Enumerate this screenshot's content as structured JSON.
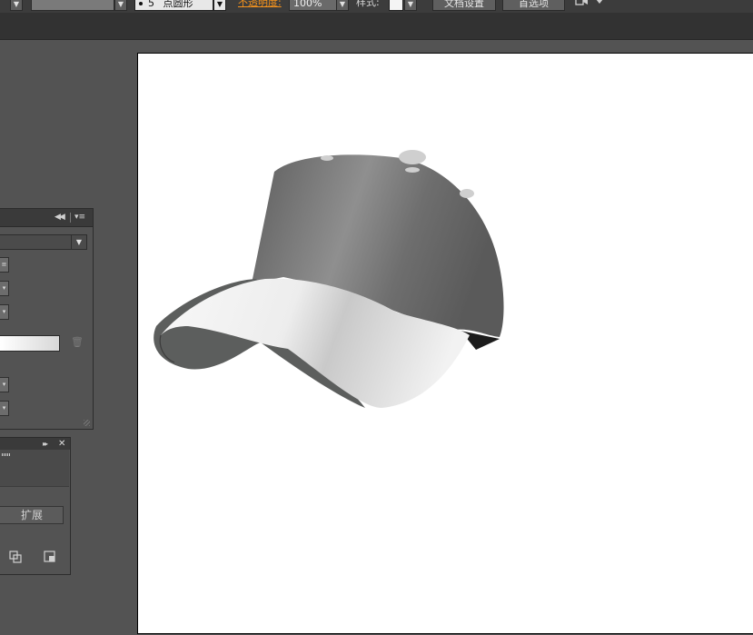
{
  "control_bar": {
    "point_count": "5",
    "brush_shape": "点圆形",
    "opacity_label": "不透明度:",
    "opacity_value": "100%",
    "style_label": "样式:",
    "doc_settings_button": "文档设置",
    "preferences_button": "首选项"
  },
  "gradient_panel": {
    "collapse_glyph": "◀◀",
    "menu_glyph": "▾≡",
    "type_value": "",
    "trash_glyph": "🗑"
  },
  "panel2": {
    "expand_glyph": "▸▸",
    "close_glyph": "✕",
    "expand_button": "扩展"
  },
  "colors": {
    "workspace": "#535353",
    "artboard": "#ffffff",
    "accent_label": "#f7941d",
    "cap_crown": "#7a7a7a",
    "cap_brim": "#e0e0e0"
  }
}
